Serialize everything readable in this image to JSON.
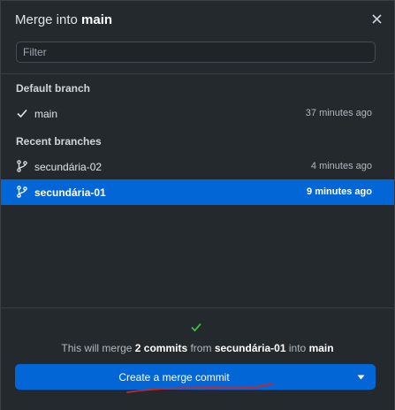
{
  "dialog": {
    "title_prefix": "Merge into",
    "title_branch": "main"
  },
  "filter": {
    "placeholder": "Filter",
    "value": ""
  },
  "sections": {
    "default_label": "Default branch",
    "recent_label": "Recent branches"
  },
  "default_branch": {
    "name": "main",
    "time": "37 minutes ago",
    "icon": "check-icon"
  },
  "recent_branches": [
    {
      "name": "secundária-02",
      "time": "4 minutes ago",
      "icon": "git-branch-icon",
      "selected": false
    },
    {
      "name": "secundária-01",
      "time": "9 minutes ago",
      "icon": "git-branch-icon",
      "selected": true
    }
  ],
  "footer": {
    "summary_prefix": "This will merge",
    "commit_count": "2 commits",
    "from_word": "from",
    "source_branch": "secundária-01",
    "into_word": "into",
    "target_branch": "main",
    "button_label": "Create a merge commit"
  },
  "colors": {
    "background": "#24292e",
    "accent": "#0366d6",
    "success": "#3fb950",
    "annotation": "#c62828"
  }
}
